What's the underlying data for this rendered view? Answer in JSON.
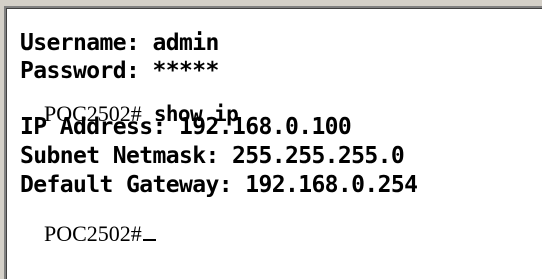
{
  "terminal": {
    "username_line": "Username: admin",
    "password_line": "Password: *****",
    "prompt": "POC2502#",
    "command": " show ip",
    "ip_address_line": "IP Address: 192.168.0.100",
    "subnet_line": "Subnet Netmask: 255.255.255.0",
    "gateway_line": "Default Gateway: 192.168.0.254",
    "final_prompt": "POC2502#"
  }
}
